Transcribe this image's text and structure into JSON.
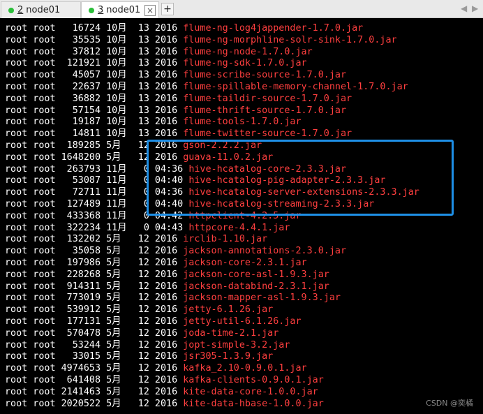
{
  "tabs": [
    {
      "num": "2",
      "label": "node01",
      "close": "×",
      "status_color": "#2bbf3a"
    },
    {
      "num": "3",
      "label": "node01",
      "close": "×",
      "status_color": "#2bbf3a"
    }
  ],
  "newtab": "+",
  "nav": {
    "prev": "◀",
    "next": "▶"
  },
  "terminal": {
    "lines": [
      {
        "meta": "root root   16724 10月  13 2016 ",
        "file": "flume-ng-log4jappender-1.7.0.jar"
      },
      {
        "meta": "root root   35535 10月  13 2016 ",
        "file": "flume-ng-morphline-solr-sink-1.7.0.jar"
      },
      {
        "meta": "root root   37812 10月  13 2016 ",
        "file": "flume-ng-node-1.7.0.jar"
      },
      {
        "meta": "root root  121921 10月  13 2016 ",
        "file": "flume-ng-sdk-1.7.0.jar"
      },
      {
        "meta": "root root   45057 10月  13 2016 ",
        "file": "flume-scribe-source-1.7.0.jar"
      },
      {
        "meta": "root root   22637 10月  13 2016 ",
        "file": "flume-spillable-memory-channel-1.7.0.jar"
      },
      {
        "meta": "root root   36882 10月  13 2016 ",
        "file": "flume-taildir-source-1.7.0.jar"
      },
      {
        "meta": "root root   57154 10月  13 2016 ",
        "file": "flume-thrift-source-1.7.0.jar"
      },
      {
        "meta": "root root   19187 10月  13 2016 ",
        "file": "flume-tools-1.7.0.jar"
      },
      {
        "meta": "root root   14811 10月  13 2016 ",
        "file": "flume-twitter-source-1.7.0.jar"
      },
      {
        "meta": "root root  189285 5月   12 2016 ",
        "file": "gson-2.2.2.jar"
      },
      {
        "meta": "root root 1648200 5月   12 2016 ",
        "file": "guava-11.0.2.jar"
      },
      {
        "meta": "root root  263793 11月   0 04:36 ",
        "file": "hive-hcatalog-core-2.3.3.jar"
      },
      {
        "meta": "root root   53087 11月   0 04:40 ",
        "file": "hive-hcatalog-pig-adapter-2.3.3.jar"
      },
      {
        "meta": "root root   72711 11月   0 04:36 ",
        "file": "hive-hcatalog-server-extensions-2.3.3.jar"
      },
      {
        "meta": "root root  127489 11月   0 04:40 ",
        "file": "hive-hcatalog-streaming-2.3.3.jar"
      },
      {
        "meta": "root root  433368 11月   0 04:42 ",
        "file": "httpclient-4.2.5.jar"
      },
      {
        "meta": "root root  322234 11月   0 04:43 ",
        "file": "httpcore-4.4.1.jar"
      },
      {
        "meta": "root root  132202 5月   12 2016 ",
        "file": "irclib-1.10.jar"
      },
      {
        "meta": "root root   35058 5月   12 2016 ",
        "file": "jackson-annotations-2.3.0.jar"
      },
      {
        "meta": "root root  197986 5月   12 2016 ",
        "file": "jackson-core-2.3.1.jar"
      },
      {
        "meta": "root root  228268 5月   12 2016 ",
        "file": "jackson-core-asl-1.9.3.jar"
      },
      {
        "meta": "root root  914311 5月   12 2016 ",
        "file": "jackson-databind-2.3.1.jar"
      },
      {
        "meta": "root root  773019 5月   12 2016 ",
        "file": "jackson-mapper-asl-1.9.3.jar"
      },
      {
        "meta": "root root  539912 5月   12 2016 ",
        "file": "jetty-6.1.26.jar"
      },
      {
        "meta": "root root  177131 5月   12 2016 ",
        "file": "jetty-util-6.1.26.jar"
      },
      {
        "meta": "root root  570478 5月   12 2016 ",
        "file": "joda-time-2.1.jar"
      },
      {
        "meta": "root root   53244 5月   12 2016 ",
        "file": "jopt-simple-3.2.jar"
      },
      {
        "meta": "root root   33015 5月   12 2016 ",
        "file": "jsr305-1.3.9.jar"
      },
      {
        "meta": "root root 4974653 5月   12 2016 ",
        "file": "kafka_2.10-0.9.0.1.jar"
      },
      {
        "meta": "root root  641408 5月   12 2016 ",
        "file": "kafka-clients-0.9.0.1.jar"
      },
      {
        "meta": "root root 2141463 5月   12 2016 ",
        "file": "kite-data-core-1.0.0.jar"
      },
      {
        "meta": "root root 2020522 5月   12 2016 ",
        "file": "kite-data-hbase-1.0.0.jar"
      }
    ]
  },
  "highlight_color": "#1e8fe6",
  "watermark": "CSDN @奕橘"
}
